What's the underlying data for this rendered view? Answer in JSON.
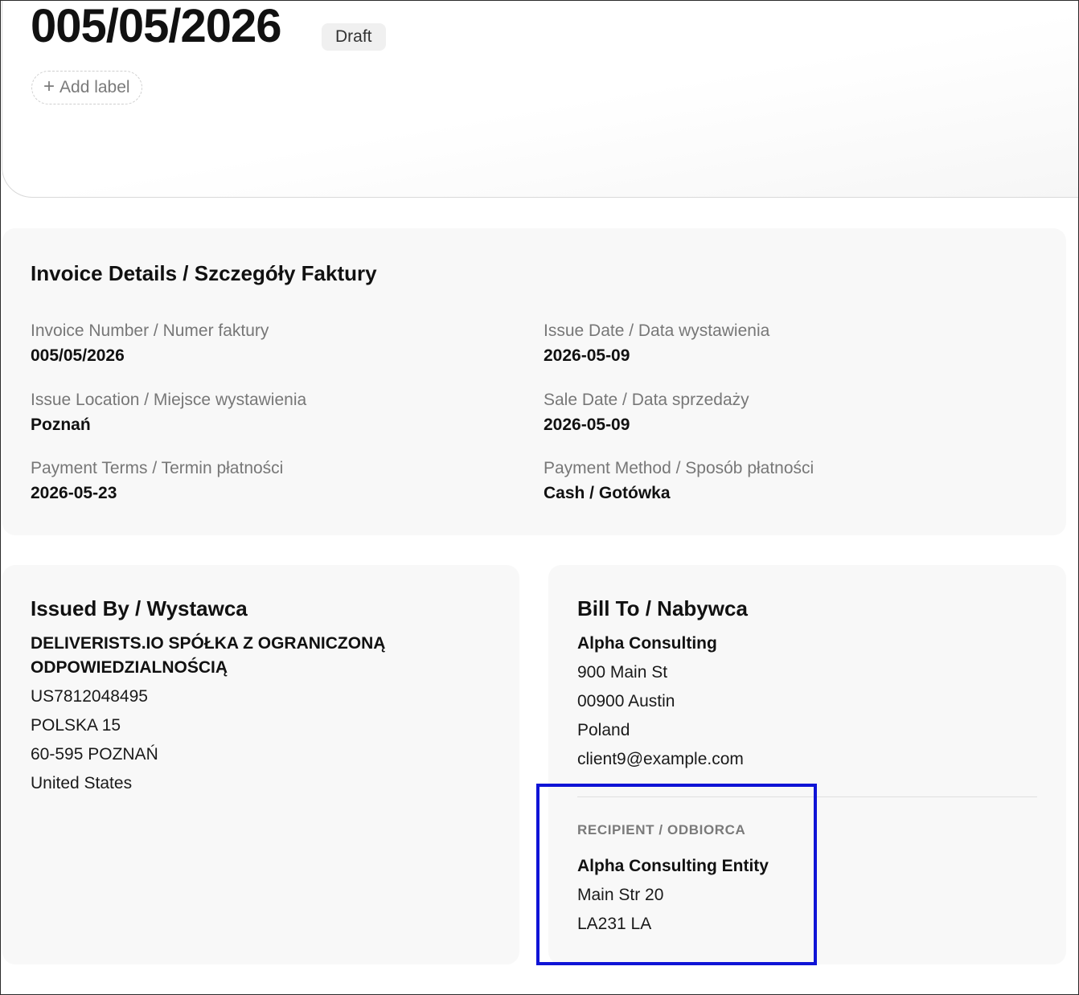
{
  "header": {
    "title": "005/05/2026",
    "status": "Draft",
    "add_label": "Add label"
  },
  "details": {
    "title": "Invoice Details / Szczegóły Faktury",
    "invoice_number_label": "Invoice Number / Numer faktury",
    "invoice_number": "005/05/2026",
    "issue_date_label": "Issue Date / Data wystawienia",
    "issue_date": "2026-05-09",
    "issue_location_label": "Issue Location / Miejsce wystawienia",
    "issue_location": "Poznań",
    "sale_date_label": "Sale Date / Data sprzedaży",
    "sale_date": "2026-05-09",
    "payment_terms_label": "Payment Terms / Termin płatności",
    "payment_terms": "2026-05-23",
    "payment_method_label": "Payment Method / Sposób płatności",
    "payment_method": "Cash / Gotówka"
  },
  "issued_by": {
    "title": "Issued By / Wystawca",
    "name": "DELIVERISTS.IO SPÓŁKA Z OGRANICZONĄ ODPOWIEDZIALNOŚCIĄ",
    "tax_id": "US7812048495",
    "street": "POLSKA 15",
    "city": "60-595 POZNAŃ",
    "country": "United States"
  },
  "bill_to": {
    "title": "Bill To / Nabywca",
    "name": "Alpha Consulting",
    "street": "900 Main St",
    "city": "00900 Austin",
    "country": "Poland",
    "email": "client9@example.com"
  },
  "recipient": {
    "heading": "RECIPIENT / ODBIORCA",
    "name": "Alpha Consulting Entity",
    "street": "Main Str 20",
    "city": "LA231 LA"
  },
  "colors": {
    "highlight": "#0f14d6",
    "card_background": "#f8f8f8",
    "label_gray": "#777777"
  },
  "icons": {
    "add_label": "plus-icon"
  }
}
